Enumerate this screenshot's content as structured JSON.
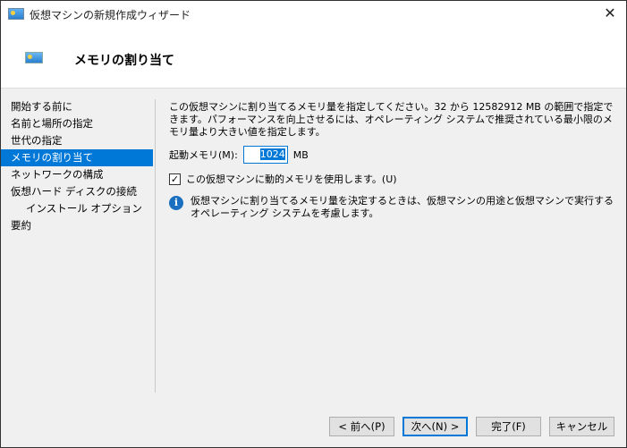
{
  "window": {
    "title": "仮想マシンの新規作成ウィザード",
    "close": "✕"
  },
  "header": {
    "title": "メモリの割り当て"
  },
  "sidebar": {
    "items": [
      {
        "label": "開始する前に"
      },
      {
        "label": "名前と場所の指定"
      },
      {
        "label": "世代の指定"
      },
      {
        "label": "メモリの割り当て"
      },
      {
        "label": "ネットワークの構成"
      },
      {
        "label": "仮想ハード ディスクの接続"
      },
      {
        "label": "インストール オプション"
      },
      {
        "label": "要約"
      }
    ]
  },
  "main": {
    "description": "この仮想マシンに割り当てるメモリ量を指定してください。32 から 12582912 MB の範囲で指定できます。パフォーマンスを向上させるには、オペレーティング システムで推奨されている最小限のメモリ量より大きい値を指定します。",
    "startup_label": "起動メモリ(M):",
    "startup_value": "1024",
    "unit": "MB",
    "dynamic_label": "この仮想マシンに動的メモリを使用します。(U)",
    "dynamic_checked": "✓",
    "info_icon": "i",
    "info_text": "仮想マシンに割り当てるメモリ量を決定するときは、仮想マシンの用途と仮想マシンで実行するオペレーティング システムを考慮します。"
  },
  "buttons": {
    "prev": "< 前へ(P)",
    "next": "次へ(N) >",
    "finish": "完了(F)",
    "cancel": "キャンセル"
  }
}
